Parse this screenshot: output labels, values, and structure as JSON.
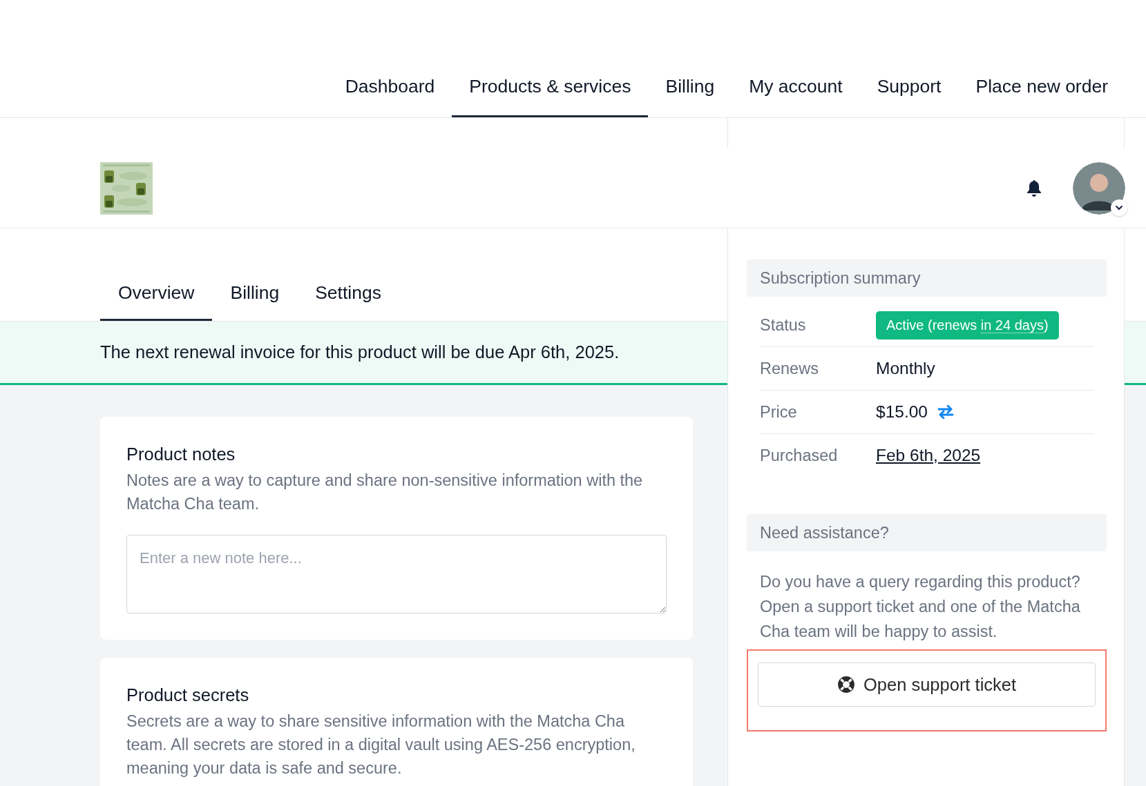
{
  "nav": {
    "items": [
      {
        "label": "Dashboard",
        "selected": false
      },
      {
        "label": "Products & services",
        "selected": true
      },
      {
        "label": "Billing",
        "selected": false
      },
      {
        "label": "My account",
        "selected": false
      },
      {
        "label": "Support",
        "selected": false
      },
      {
        "label": "Place new order",
        "selected": false
      }
    ]
  },
  "product": {
    "tabs": [
      {
        "label": "Overview",
        "selected": true
      },
      {
        "label": "Billing",
        "selected": false
      },
      {
        "label": "Settings",
        "selected": false
      }
    ],
    "notice": "The next renewal invoice for this product will be due Apr 6th, 2025."
  },
  "cards": [
    {
      "title": "Product notes",
      "description": "Notes are a way to capture and share non-sensitive information with the Matcha Cha team.",
      "placeholder": "Enter a new note here..."
    },
    {
      "title": "Product secrets",
      "description": "Secrets are a way to share sensitive information with the Matcha Cha team. All secrets are stored in a digital vault using AES-256 encryption, meaning your data is safe and secure."
    }
  ],
  "summary": {
    "title": "Subscription summary",
    "rows": [
      {
        "kind": "badge",
        "label": "Status",
        "value": "Active (renews ",
        "hint": "in 24 days",
        "suffix": ")"
      },
      {
        "kind": "text",
        "label": "Renews",
        "value": "Monthly"
      },
      {
        "kind": "price",
        "label": "Price",
        "value": "$15.00"
      },
      {
        "kind": "link",
        "label": "Purchased",
        "value": "Feb 6th, 2025"
      }
    ]
  },
  "assistance": {
    "title": "Need assistance?",
    "text": "Do you have a query regarding this product? Open a support ticket and one of the Matcha Cha team will be happy to assist.",
    "button": "Open support ticket",
    "highlighted": true
  }
}
